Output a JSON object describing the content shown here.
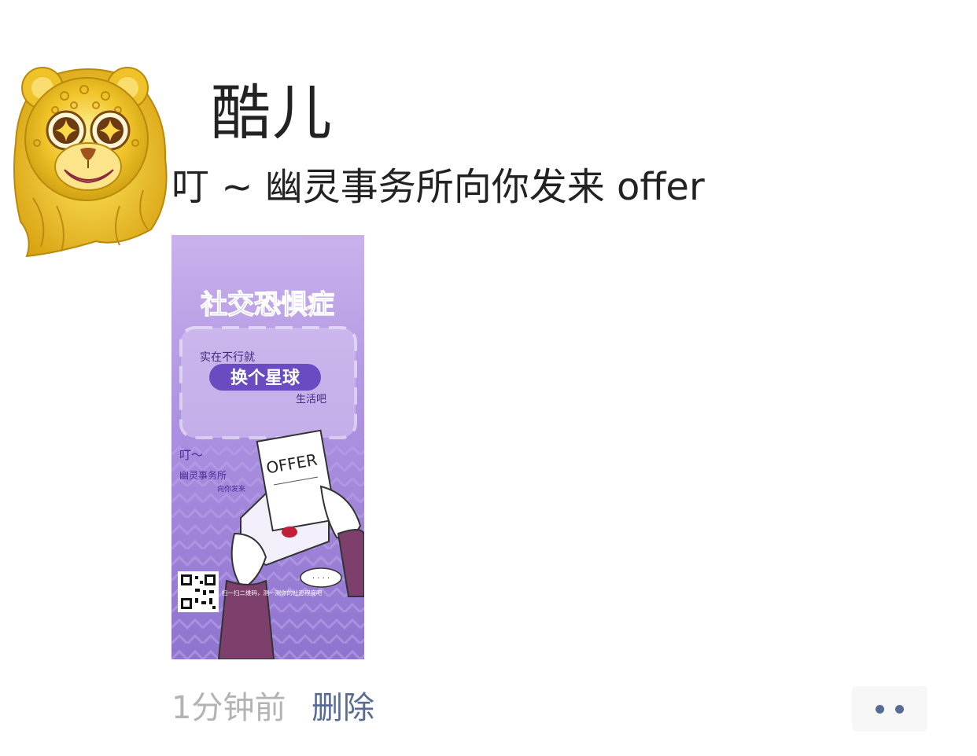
{
  "post": {
    "username": "酷儿",
    "text": "叮 ~ 幽灵事务所向你发来 offer",
    "timestamp": "1分钟前",
    "delete_label": "删除"
  },
  "avatar": {
    "icon": "golden-lion-avatar"
  },
  "poster": {
    "title": "社交恐惧症",
    "line1": "实在不行就",
    "line2": "换个星球",
    "line3": "生活吧",
    "ding": "叮～",
    "office": "幽灵事务所",
    "sent_to_you": "向你发来",
    "offer_word": "OFFER",
    "scan_hint": "扫一扫二维码，测一测你的社恐程度吧",
    "speech_bubble": "· · · ·"
  },
  "more_button": {
    "icon": "more-dots-icon"
  },
  "colors": {
    "link": "#576b95",
    "muted": "#b3b3b3",
    "text": "#222222",
    "poster_purple": "#8f6fd0",
    "avatar_gold": "#e8b817"
  }
}
